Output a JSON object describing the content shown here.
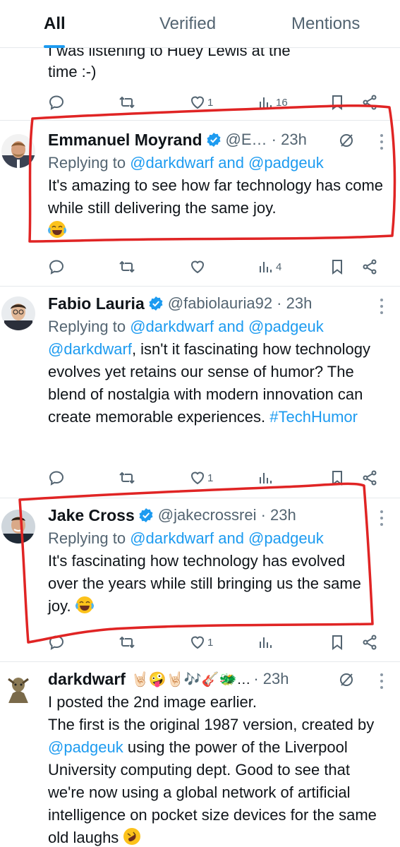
{
  "tabs": [
    {
      "label": "All",
      "active": true
    },
    {
      "label": "Verified",
      "active": false
    },
    {
      "label": "Mentions",
      "active": false
    }
  ],
  "clipped_tweet": {
    "line1": "I was listening to Huey Lewis at the",
    "line2": "time :-)",
    "likes": "1",
    "views": "16"
  },
  "tweets": [
    {
      "name": "Emmanuel Moyrand",
      "handle": "@E… · 23h",
      "verified": true,
      "reply_prefix": "Replying to ",
      "reply_users": "@darkdwarf and @padgeuk",
      "text": "It's amazing to see how far technology has come while still delivering the same joy.",
      "emoji": "face-with-tears-of-joy",
      "views": "4"
    },
    {
      "name": "Fabio Lauria",
      "handle": "@fabiolauria92 · 23h",
      "verified": true,
      "reply_prefix": "Replying to ",
      "reply_users": "@darkdwarf and @padgeuk",
      "mention": "@darkdwarf",
      "text": ", isn't it fascinating how technology evolves yet retains our sense of humor? The blend of nostalgia with modern innovation can create memorable experiences.  ",
      "hashtag": "#TechHumor",
      "likes": "1"
    },
    {
      "name": "Jake Cross",
      "handle": "@jakecrossrei · 23h",
      "verified": true,
      "reply_prefix": "Replying to ",
      "reply_users": "@darkdwarf and @padgeuk",
      "text": "It's fascinating how technology has evolved over the years while still bringing us the same joy. ",
      "emoji": "face-with-tears-of-joy",
      "likes": "1"
    },
    {
      "name": "darkdwarf",
      "name_emojis": "🤘🏻🤪🤘🏻🎶🎸🐲…",
      "handle": "· 23h",
      "verified": false,
      "text_a": "I posted the 2nd image earlier.",
      "text_b": "The first is the original 1987 version, created by ",
      "mention": "@padgeuk",
      "text_c": " using the power of the Liverpool University computing dept. Good to see that we're now using a global network of artificial intelligence on pocket size devices for the same old laughs",
      "emoji": "rolling-on-floor-laughing"
    }
  ],
  "colors": {
    "accent": "#1d9bf0",
    "secondary_text": "#536471",
    "annotation": "#e02424"
  }
}
